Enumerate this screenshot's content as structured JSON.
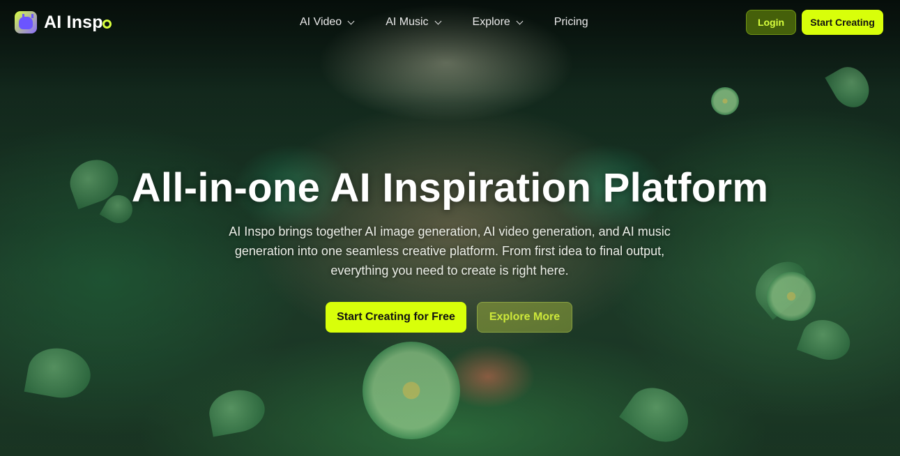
{
  "header": {
    "logo_text": "AI Insp",
    "logo_suffix": "o",
    "nav": [
      {
        "label": "AI Video",
        "has_dropdown": true
      },
      {
        "label": "AI Music",
        "has_dropdown": true
      },
      {
        "label": "Explore",
        "has_dropdown": true
      },
      {
        "label": "Pricing",
        "has_dropdown": false
      }
    ],
    "login_label": "Login",
    "start_label": "Start Creating"
  },
  "hero": {
    "title": "All-in-one AI Inspiration Platform",
    "subtitle": "AI Inspo brings together AI image generation, AI video generation, and AI music generation into one seamless creative platform. From first idea to final output, everything you need to create is right here.",
    "primary_cta": "Start Creating for Free",
    "secondary_cta": "Explore More"
  },
  "colors": {
    "accent": "#d8ff0a",
    "accent_dark": "#506e0a",
    "background": "#1b3a28"
  }
}
